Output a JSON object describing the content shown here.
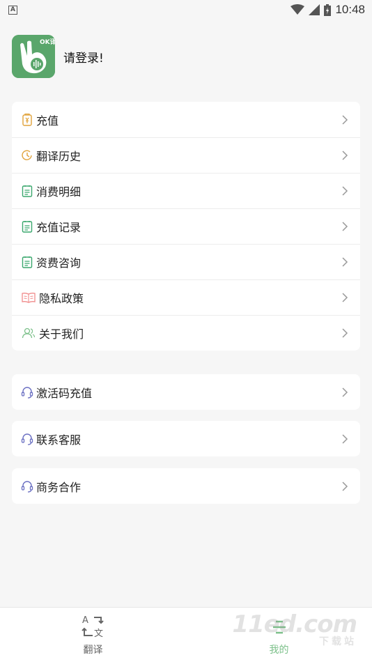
{
  "status_bar": {
    "time": "10:48",
    "notification_icon_letter": "A"
  },
  "profile": {
    "login_prompt": "请登录!",
    "logo_text": "OK译"
  },
  "menu_main": [
    {
      "label": "充值",
      "icon": "wallet-icon",
      "icon_color": "#e0a23a"
    },
    {
      "label": "翻译历史",
      "icon": "clock-icon",
      "icon_color": "#e0a23a"
    },
    {
      "label": "消费明细",
      "icon": "list-doc-icon",
      "icon_color": "#3aa76d"
    },
    {
      "label": "充值记录",
      "icon": "list-doc-icon",
      "icon_color": "#3aa76d"
    },
    {
      "label": "资费咨询",
      "icon": "list-doc-icon",
      "icon_color": "#3aa76d"
    },
    {
      "label": "隐私政策",
      "icon": "book-icon",
      "icon_color": "#f08b8b"
    },
    {
      "label": "关于我们",
      "icon": "users-icon",
      "icon_color": "#7cc08a"
    }
  ],
  "menu_activate": {
    "label": "激活码充值",
    "icon": "headset-icon",
    "icon_color": "#6a6fc2"
  },
  "menu_service": {
    "label": "联系客服",
    "icon": "headset-icon",
    "icon_color": "#6a6fc2"
  },
  "menu_business": {
    "label": "商务合作",
    "icon": "headset-icon",
    "icon_color": "#6a6fc2"
  },
  "bottom_nav": [
    {
      "label": "翻译",
      "icon": "translate-icon",
      "active": false
    },
    {
      "label": "我的",
      "icon": "profile-list-icon",
      "active": true
    }
  ],
  "colors": {
    "accent": "#7cc08a",
    "logo_bg": "#5aa66b",
    "background": "#f6f6f6"
  },
  "watermark": {
    "main": "11ed.com",
    "sub": "下载站"
  }
}
